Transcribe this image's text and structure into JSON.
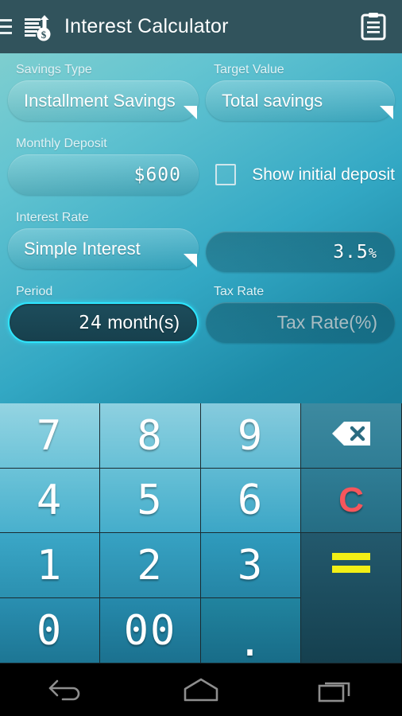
{
  "titlebar": {
    "menu_icon": "hamburger-menu-icon",
    "app_icon": "interest-chart-dollar-icon",
    "title": "Interest Calculator",
    "action_icon": "clipboard-icon"
  },
  "form": {
    "savings_type": {
      "label": "Savings Type",
      "value": "Installment Savings"
    },
    "target_value": {
      "label": "Target Value",
      "value": "Total savings"
    },
    "monthly_deposit": {
      "label": "Monthly Deposit",
      "value": "$600"
    },
    "show_initial_deposit": {
      "label": "Show initial deposit",
      "checked": false
    },
    "interest_rate": {
      "label": "Interest Rate",
      "value": "Simple Interest"
    },
    "rate_value": {
      "number": "3.5",
      "unit": "%"
    },
    "period": {
      "label": "Period",
      "number": "24",
      "suffix": " month(s)",
      "focused": true
    },
    "tax_rate": {
      "label": "Tax Rate",
      "placeholder": "Tax Rate(%)",
      "value": ""
    }
  },
  "keypad": {
    "keys": [
      {
        "label": "7",
        "name": "key-7"
      },
      {
        "label": "8",
        "name": "key-8"
      },
      {
        "label": "9",
        "name": "key-9"
      },
      {
        "label": "4",
        "name": "key-4"
      },
      {
        "label": "5",
        "name": "key-5"
      },
      {
        "label": "6",
        "name": "key-6"
      },
      {
        "label": "1",
        "name": "key-1"
      },
      {
        "label": "2",
        "name": "key-2"
      },
      {
        "label": "3",
        "name": "key-3"
      },
      {
        "label": "0",
        "name": "key-0"
      },
      {
        "label": "00",
        "name": "key-double-zero"
      },
      {
        "label": ".",
        "name": "key-decimal-point"
      }
    ],
    "backspace": {
      "icon": "backspace-icon"
    },
    "clear": {
      "label": "C",
      "name": "key-clear"
    },
    "equals": {
      "icon": "equals-icon",
      "label": "="
    }
  },
  "navbar": {
    "back": "back-icon",
    "home": "home-icon",
    "recents": "recents-icon"
  },
  "colors": {
    "titlebar": "#31535c",
    "accent_focus": "#2ee6ff",
    "clear_red": "#f6565c",
    "equals_yellow": "#f2ef16",
    "keypad_dark": "#0d2a33"
  }
}
